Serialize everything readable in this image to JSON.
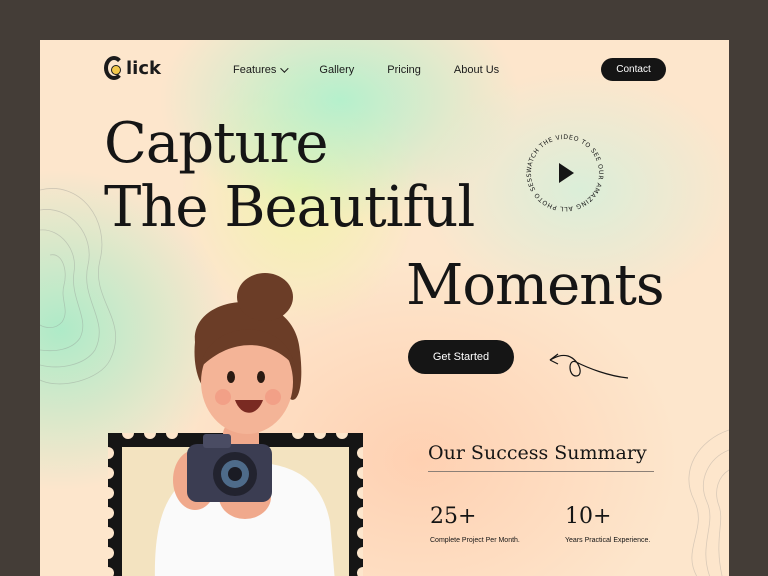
{
  "brand": {
    "name": "lick"
  },
  "nav": {
    "items": [
      {
        "label": "Features"
      },
      {
        "label": "Gallery"
      },
      {
        "label": "Pricing"
      },
      {
        "label": "About Us"
      }
    ],
    "contact_label": "Contact"
  },
  "hero": {
    "line1": "Capture",
    "line2": "The Beautiful",
    "line3": "Moments",
    "cta_label": "Get Started",
    "badge_text": "WATCH THE VIDEO TO SEE OUR AMAZING ALL PHOTO SESSION"
  },
  "summary": {
    "title": "Our Success Summary",
    "stats": [
      {
        "value": "25+",
        "label": "Complete Project Per Month."
      },
      {
        "value": "10+",
        "label": "Years Practical Experience."
      }
    ]
  },
  "colors": {
    "dark": "#151515",
    "page_bg": "#443d37",
    "accent_logo": "#f3c84a"
  }
}
